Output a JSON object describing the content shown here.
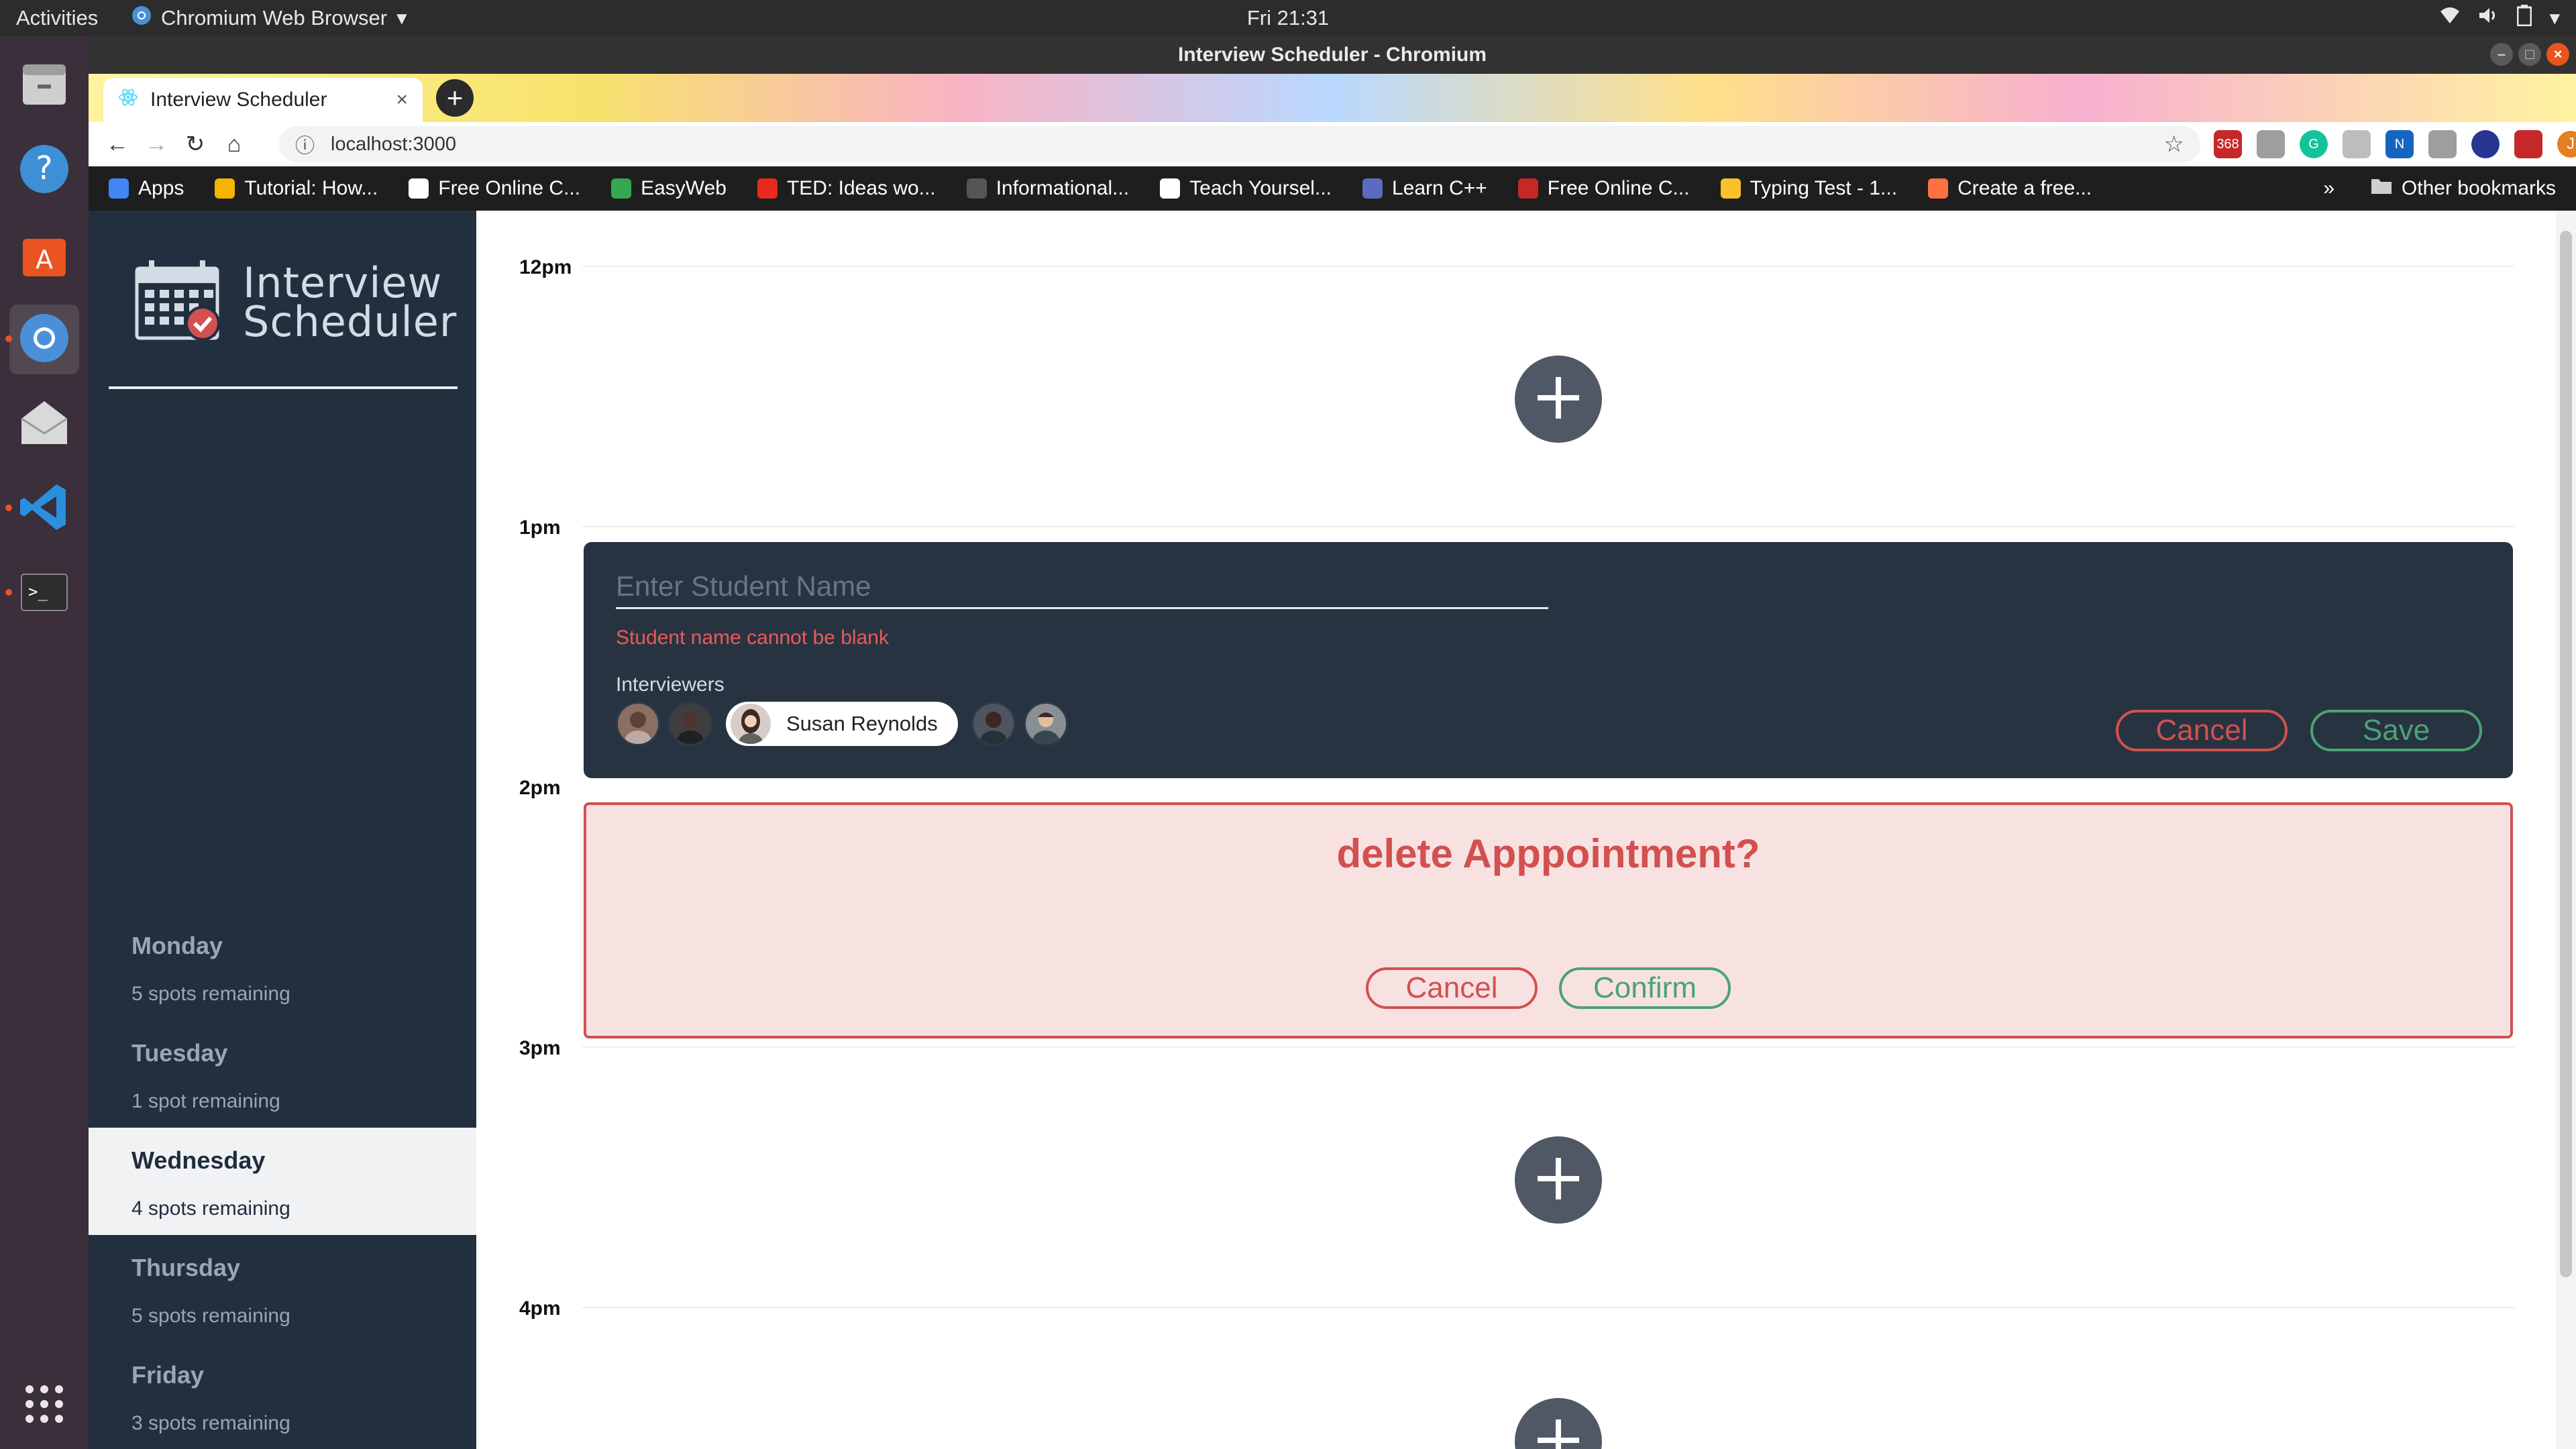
{
  "system": {
    "activities": "Activities",
    "app_menu": "Chromium Web Browser",
    "clock": "Fri 21:31"
  },
  "window": {
    "title": "Interview Scheduler - Chromium"
  },
  "browser": {
    "tab_title": "Interview Scheduler",
    "url": "localhost:3000",
    "profile_initial": "J",
    "ext_badge": "368",
    "bookmarks": [
      {
        "label": "Apps",
        "color": "#4285f4"
      },
      {
        "label": "Tutorial: How...",
        "color": "#f4b400"
      },
      {
        "label": "Free Online C...",
        "color": "#ffffff"
      },
      {
        "label": "EasyWeb",
        "color": "#34a853"
      },
      {
        "label": "TED: Ideas wo...",
        "color": "#e62b1e"
      },
      {
        "label": "Informational...",
        "color": "#555555"
      },
      {
        "label": "Teach Yoursel...",
        "color": "#ffffff"
      },
      {
        "label": "Learn C++",
        "color": "#5c6bc0"
      },
      {
        "label": "Free Online C...",
        "color": "#c62828"
      },
      {
        "label": "Typing Test - 1...",
        "color": "#fbc02d"
      },
      {
        "label": "Create a free...",
        "color": "#ff7043"
      }
    ],
    "bookmarks_overflow": "»",
    "other_bookmarks": "Other bookmarks"
  },
  "sidebar": {
    "brand_line1": "Interview",
    "brand_line2": "Scheduler",
    "days": [
      {
        "name": "Monday",
        "spots": "5 spots remaining"
      },
      {
        "name": "Tuesday",
        "spots": "1 spot remaining"
      },
      {
        "name": "Wednesday",
        "spots": "4 spots remaining",
        "selected": true
      },
      {
        "name": "Thursday",
        "spots": "5 spots remaining"
      },
      {
        "name": "Friday",
        "spots": "3 spots remaining"
      }
    ]
  },
  "schedule": {
    "times": [
      "12pm",
      "1pm",
      "2pm",
      "3pm",
      "4pm"
    ],
    "form": {
      "placeholder": "Enter Student Name",
      "error": "Student name cannot be blank",
      "interviewers_label": "Interviewers",
      "selected_interviewer": "Susan Reynolds",
      "cancel": "Cancel",
      "save": "Save"
    },
    "confirm": {
      "message": "delete Apppointment?",
      "cancel": "Cancel",
      "confirm": "Confirm"
    }
  },
  "colors": {
    "sidebar_bg": "#222f3e",
    "form_bg": "#283341",
    "danger": "#d25050",
    "success": "#4aa374",
    "confirm_bg": "#f8e1e1"
  }
}
